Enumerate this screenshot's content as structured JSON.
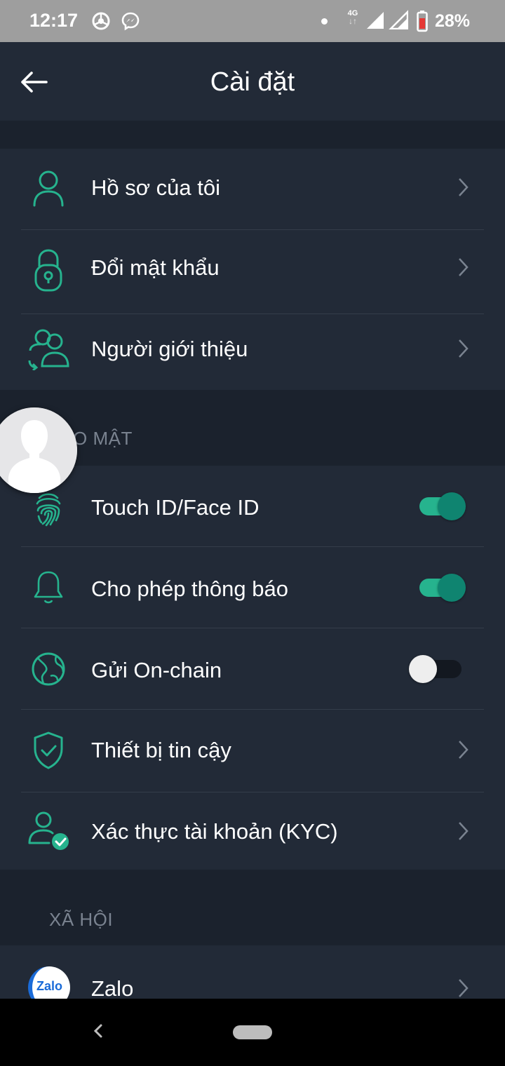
{
  "status_bar": {
    "time": "12:17",
    "network": "4G",
    "battery": "28%"
  },
  "header": {
    "title": "Cài đặt"
  },
  "account": {
    "items": [
      {
        "label": "Hồ sơ của tôi",
        "icon": "user-icon"
      },
      {
        "label": "Đổi mật khẩu",
        "icon": "lock-icon"
      },
      {
        "label": "Người giới thiệu",
        "icon": "referral-icon"
      }
    ]
  },
  "security": {
    "section_title": "O MẬT",
    "items": [
      {
        "label": "Touch ID/Face ID",
        "icon": "fingerprint-icon",
        "toggle": true
      },
      {
        "label": "Cho phép thông báo",
        "icon": "bell-icon",
        "toggle": true
      },
      {
        "label": "Gửi On-chain",
        "icon": "globe-icon",
        "toggle": false
      },
      {
        "label": "Thiết bị tin cậy",
        "icon": "shield-check-icon"
      },
      {
        "label": "Xác thực tài khoản (KYC)",
        "icon": "user-verified-icon"
      }
    ]
  },
  "social": {
    "section_title": "XÃ HỘI",
    "items": [
      {
        "label": "Zalo",
        "icon": "zalo-logo",
        "logo_text": "Zalo"
      }
    ]
  },
  "colors": {
    "accent": "#26b38e",
    "background": "#1b222d",
    "card": "#222a37",
    "statusbar": "#9e9e9e"
  }
}
